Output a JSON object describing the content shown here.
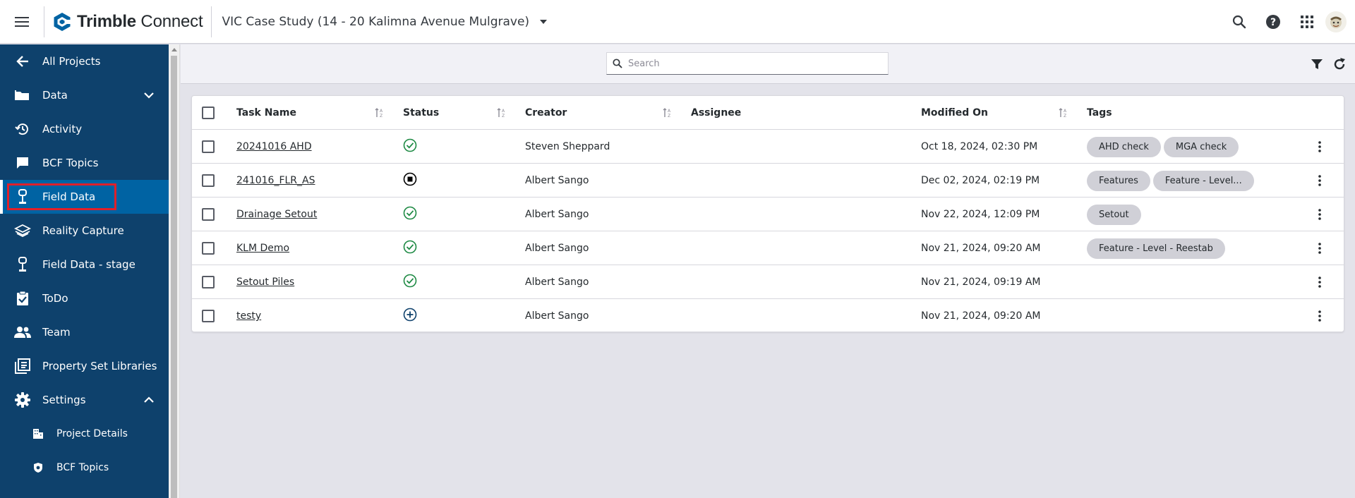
{
  "header": {
    "brand": "Trimble Connect",
    "brand_bold": "Trimble",
    "brand_light": " Connect",
    "project_title": "VIC Case Study (14 - 20 Kalimna Avenue Mulgrave)"
  },
  "sidebar": {
    "items": [
      {
        "label": "All Projects",
        "icon": "arrow-left-icon"
      },
      {
        "label": "Data",
        "icon": "folder-icon"
      },
      {
        "label": "Activity",
        "icon": "history-icon"
      },
      {
        "label": "BCF Topics",
        "icon": "chat-icon"
      },
      {
        "label": "Field Data",
        "icon": "survey-rover-icon"
      },
      {
        "label": "Reality Capture",
        "icon": "layers-icon"
      },
      {
        "label": "Field Data - stage",
        "icon": "survey-rover-icon"
      },
      {
        "label": "ToDo",
        "icon": "clipboard-check-icon"
      },
      {
        "label": "Team",
        "icon": "team-icon"
      },
      {
        "label": "Property Set Libraries",
        "icon": "library-icon"
      },
      {
        "label": "Settings",
        "icon": "gear-icon"
      },
      {
        "label": "Project Details",
        "icon": "building-icon"
      },
      {
        "label": "BCF Topics",
        "icon": "shield-gear-icon"
      }
    ]
  },
  "toolbar": {
    "search_placeholder": "Search"
  },
  "table": {
    "columns": [
      "Task Name",
      "Status",
      "Creator",
      "Assignee",
      "Modified On",
      "Tags"
    ],
    "rows": [
      {
        "name": "20241016 AHD",
        "status": "completed",
        "creator": "Steven Sheppard",
        "assignee": "",
        "modified": "Oct 18, 2024, 02:30 PM",
        "tags": [
          "AHD check",
          "MGA check"
        ]
      },
      {
        "name": "241016_FLR_AS",
        "status": "stopped",
        "creator": "Albert Sango",
        "assignee": "",
        "modified": "Dec 02, 2024, 02:19 PM",
        "tags": [
          "Features",
          "Feature - Level..."
        ]
      },
      {
        "name": "Drainage Setout",
        "status": "completed",
        "creator": "Albert Sango",
        "assignee": "",
        "modified": "Nov 22, 2024, 12:09 PM",
        "tags": [
          "Setout"
        ]
      },
      {
        "name": "KLM Demo",
        "status": "completed",
        "creator": "Albert Sango",
        "assignee": "",
        "modified": "Nov 21, 2024, 09:20 AM",
        "tags": [
          "Feature - Level - Reestab"
        ]
      },
      {
        "name": "Setout Piles",
        "status": "completed",
        "creator": "Albert Sango",
        "assignee": "",
        "modified": "Nov 21, 2024, 09:19 AM",
        "tags": []
      },
      {
        "name": "testy",
        "status": "new",
        "creator": "Albert Sango",
        "assignee": "",
        "modified": "Nov 21, 2024, 09:20 AM",
        "tags": []
      }
    ]
  },
  "colors": {
    "sidebar_bg": "#0e416c",
    "sidebar_active": "#0063a3",
    "status_green": "#1e8a44",
    "status_blue": "#0063a3",
    "highlight_red": "#e0202a"
  }
}
